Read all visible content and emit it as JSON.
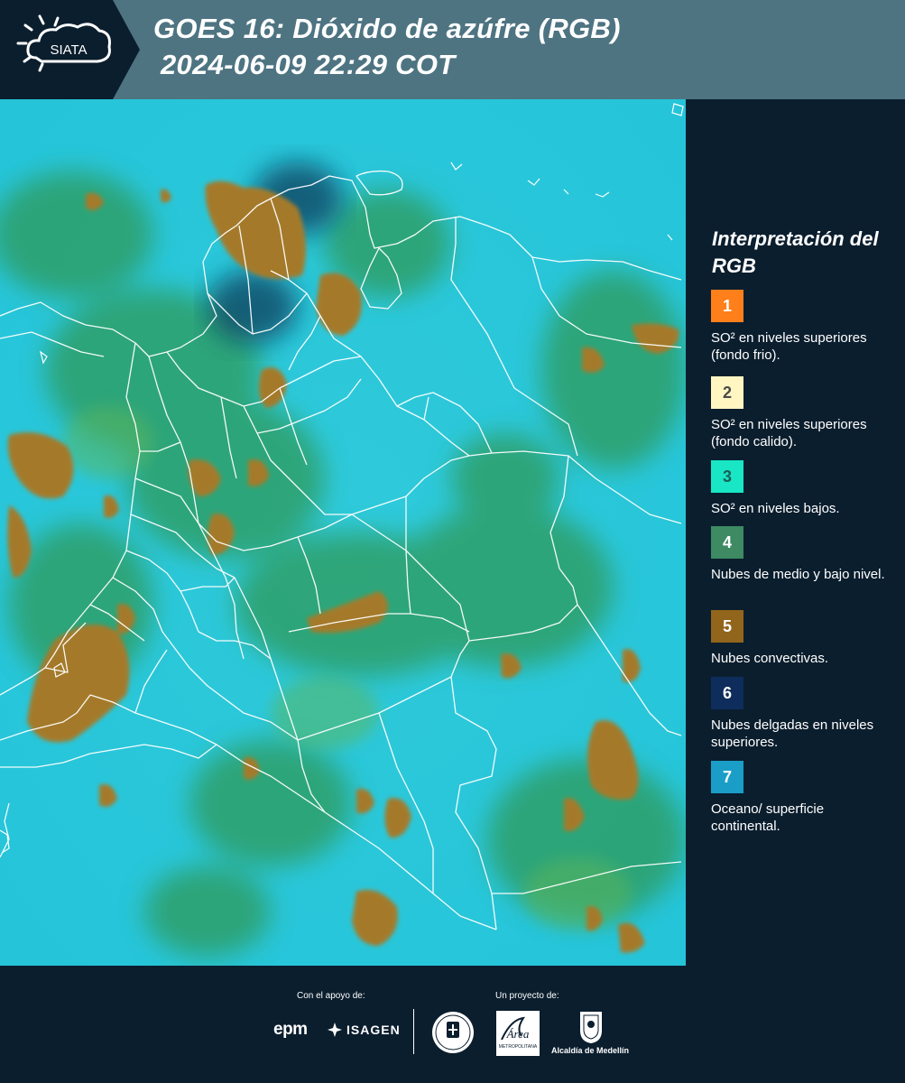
{
  "header": {
    "logo_text": "SIATA",
    "title_line1": "GOES 16: Dióxido de azúfre (RGB)",
    "title_line2": "2024-06-09 22:29 COT"
  },
  "legend": {
    "title": "Interpretación del RGB",
    "items": [
      {
        "number": "1",
        "color": "#ff7f1a",
        "text": "SO² en niveles superiores (fondo frio)."
      },
      {
        "number": "2",
        "color": "#fff6c2",
        "text": "SO² en niveles superiores (fondo calido)."
      },
      {
        "number": "3",
        "color": "#18e6c4",
        "text": "SO² en niveles bajos."
      },
      {
        "number": "4",
        "color": "#3d8a63",
        "text": "Nubes de medio y bajo nivel."
      },
      {
        "number": "5",
        "color": "#92651c",
        "text": "Nubes convectivas."
      },
      {
        "number": "6",
        "color": "#0f2d5c",
        "text": "Nubes delgadas en niveles superiores."
      },
      {
        "number": "7",
        "color": "#1a9ec8",
        "text": "Oceano/ superficie continental."
      }
    ]
  },
  "footer": {
    "support_label": "Con el apoyo de:",
    "project_label": "Un proyecto de:",
    "epm": "epm",
    "isagen": "ISAGEN",
    "area_metropolitana": "METROPOLITANA",
    "alcaldia": "Alcaldía de Medellín"
  }
}
